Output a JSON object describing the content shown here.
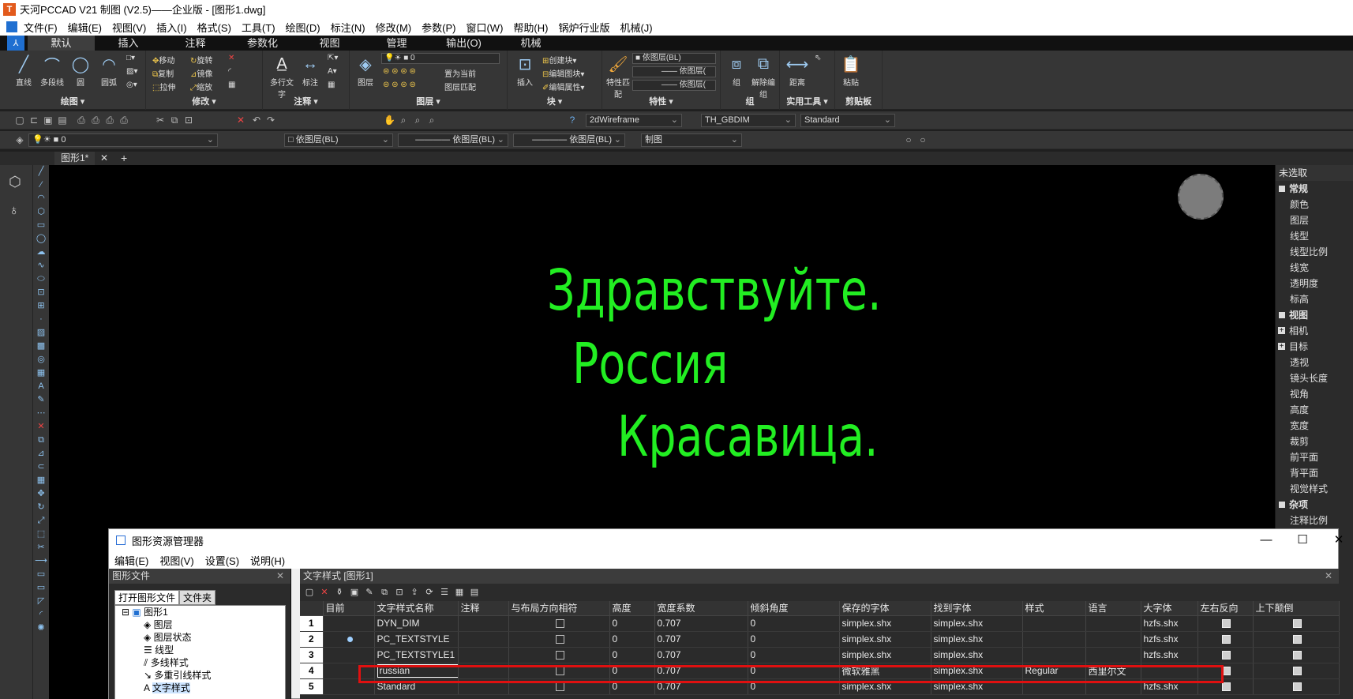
{
  "titlebar": {
    "title": "天河PCCAD V21 制图 (V2.5)——企业版 - [图形1.dwg]",
    "icon": "T"
  },
  "menu": [
    "文件(F)",
    "编辑(E)",
    "视图(V)",
    "插入(I)",
    "格式(S)",
    "工具(T)",
    "绘图(D)",
    "标注(N)",
    "修改(M)",
    "参数(P)",
    "窗口(W)",
    "帮助(H)",
    "锅炉行业版",
    "机械(J)"
  ],
  "ribbon_tabs": [
    "默认",
    "插入",
    "注释",
    "参数化",
    "视图",
    "管理",
    "输出(O)",
    "机械"
  ],
  "ribbon": {
    "draw": {
      "label": "绘图 ▾",
      "line": "直线",
      "polyline": "多段线",
      "circle": "圆",
      "arc": "圆弧"
    },
    "modify": {
      "label": "修改 ▾",
      "move": "移动",
      "rotate": "旋转",
      "copy": "复制",
      "mirror": "镜像",
      "stretch": "拉伸",
      "scale": "缩放"
    },
    "annotate": {
      "label": "注释 ▾",
      "mtext": "多行文字",
      "dim": "标注"
    },
    "layers": {
      "label": "图层 ▾",
      "layer_prop": "图层",
      "current": "0",
      "set_current": "置为当前",
      "match": "图层匹配"
    },
    "block": {
      "label": "块 ▾",
      "insert": "插入",
      "create": "创建块",
      "edit": "编辑图块",
      "edit_attr": "编辑属性"
    },
    "properties": {
      "label": "特性 ▾",
      "match": "特性匹配",
      "color": "依图层(BL)",
      "linetype": "依图层(",
      "lineweight": "依图层("
    },
    "group": {
      "label": "组",
      "group": "组",
      "ungroup": "解除编组"
    },
    "utilities": {
      "label": "实用工具 ▾",
      "measure": "距离"
    },
    "clipboard": {
      "label": "剪贴板",
      "paste": "粘贴"
    }
  },
  "toolbar1": {
    "visual_style": "2dWireframe",
    "dimstyle": "TH_GBDIM",
    "textstyle": "Standard"
  },
  "toolbar2": {
    "layer": "0",
    "color": "依图层(BL)",
    "linetype": "依图层(BL)",
    "lineweight": "依图层(BL)",
    "plotstyle": "制图"
  },
  "doc_tab": {
    "name": "图形1*",
    "close": "✕",
    "add": "+"
  },
  "canvas": {
    "line1": "Здравствуйте.",
    "line2": "Россия",
    "line3": "Красавица.",
    "text_color": "#22ee22"
  },
  "properties_panel": {
    "header": "未选取",
    "sections": [
      {
        "title": "常规",
        "items": [
          "颜色",
          "图层",
          "线型",
          "线型比例",
          "线宽",
          "透明度",
          "标高"
        ]
      },
      {
        "title": "视图",
        "items": [
          "相机",
          "目标",
          "透视",
          "镜头长度",
          "视角",
          "高度",
          "宽度",
          "裁剪",
          "前平面",
          "背平面",
          "视觉样式"
        ]
      },
      {
        "title": "杂项",
        "items": [
          "注释比例"
        ]
      }
    ]
  },
  "dialog": {
    "title": "图形资源管理器",
    "menu": [
      "编辑(E)",
      "视图(V)",
      "设置(S)",
      "说明(H)"
    ],
    "left_header": "图形文件",
    "left_tabs": [
      "打开图形文件",
      "文件夹"
    ],
    "tree": {
      "root": "图形1",
      "children": [
        "图层",
        "图层状态",
        "线型",
        "多线样式",
        "多重引线样式",
        "文字样式"
      ]
    },
    "right_header": "文字样式 [图形1]",
    "columns": [
      "",
      "目前",
      "文字样式名称",
      "注释",
      "与布局方向相符",
      "高度",
      "宽度系数",
      "倾斜角度",
      "保存的字体",
      "找到字体",
      "样式",
      "语言",
      "大字体",
      "左右反向",
      "上下颠倒"
    ],
    "rows": [
      {
        "n": "1",
        "current": false,
        "name": "DYN_DIM",
        "height": "0",
        "width": "0.707",
        "oblique": "0",
        "saved_font": "simplex.shx",
        "found_font": "simplex.shx",
        "style": "",
        "lang": "",
        "bigfont": "hzfs.shx"
      },
      {
        "n": "2",
        "current": true,
        "name": "PC_TEXTSTYLE",
        "height": "0",
        "width": "0.707",
        "oblique": "0",
        "saved_font": "simplex.shx",
        "found_font": "simplex.shx",
        "style": "",
        "lang": "",
        "bigfont": "hzfs.shx"
      },
      {
        "n": "3",
        "current": false,
        "name": "PC_TEXTSTYLE1",
        "height": "0",
        "width": "0.707",
        "oblique": "0",
        "saved_font": "simplex.shx",
        "found_font": "simplex.shx",
        "style": "",
        "lang": "",
        "bigfont": "hzfs.shx"
      },
      {
        "n": "4",
        "current": false,
        "name": "russian",
        "height": "0",
        "width": "0.707",
        "oblique": "0",
        "saved_font": "微软雅黑",
        "found_font": "simplex.shx",
        "style": "Regular",
        "lang": "西里尔文",
        "bigfont": ""
      },
      {
        "n": "5",
        "current": false,
        "name": "Standard",
        "height": "0",
        "width": "0.707",
        "oblique": "0",
        "saved_font": "simplex.shx",
        "found_font": "simplex.shx",
        "style": "",
        "lang": "",
        "bigfont": "hzfs.shx"
      }
    ]
  },
  "colors": {
    "accent": "#1f6fd1",
    "highlight": "#e01010",
    "ribbon_bg": "#363636"
  }
}
